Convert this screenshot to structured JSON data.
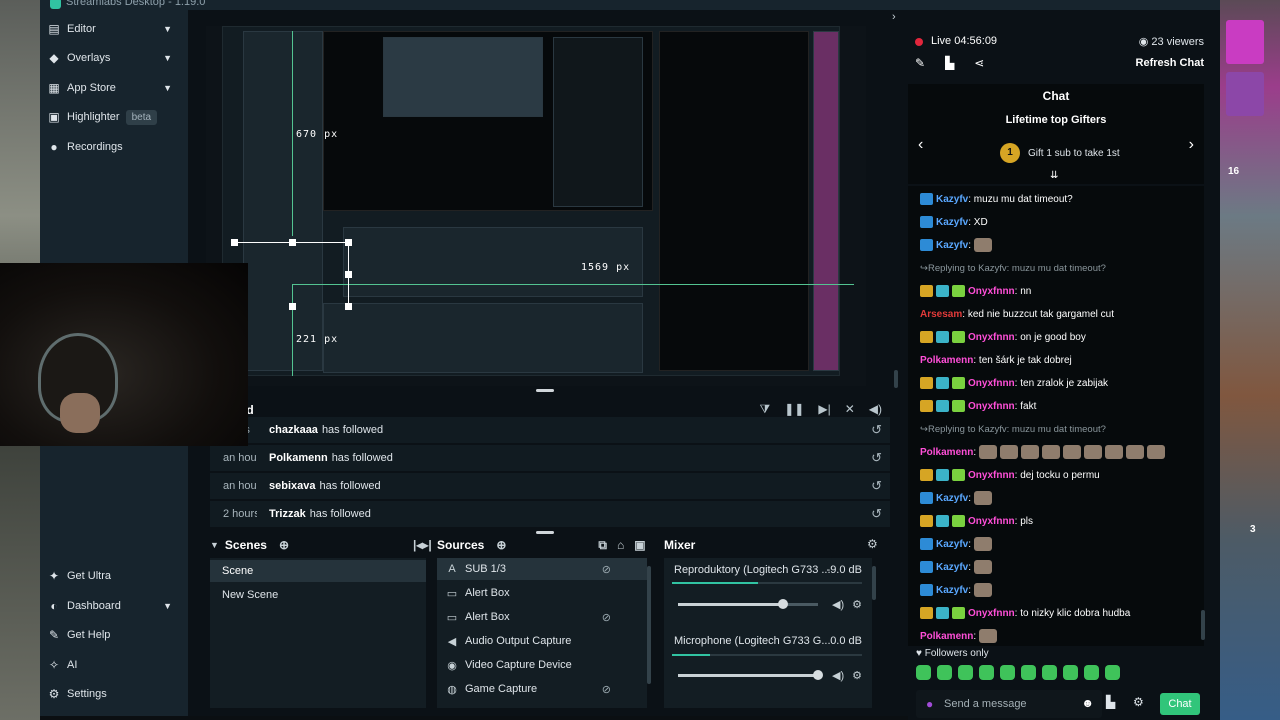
{
  "window": {
    "title": "Streamlabs Desktop - 1.19.0"
  },
  "sidebar": {
    "top_items": [
      {
        "label": "Editor",
        "icon": "editor-icon",
        "chevron": true
      },
      {
        "label": "Overlays",
        "icon": "overlays-icon",
        "chevron": true
      },
      {
        "label": "App Store",
        "icon": "app-store-icon",
        "chevron": true
      },
      {
        "label": "Highlighter",
        "icon": "highlighter-icon",
        "badge": "beta"
      },
      {
        "label": "Recordings",
        "icon": "recordings-icon"
      }
    ],
    "bottom_items": [
      {
        "label": "Get Ultra",
        "icon": "ultra-icon"
      },
      {
        "label": "Dashboard",
        "icon": "dashboard-icon",
        "chevron": true
      },
      {
        "label": "Get Help",
        "icon": "help-icon"
      },
      {
        "label": "AI",
        "icon": "ai-icon"
      },
      {
        "label": "Settings",
        "icon": "settings-icon"
      }
    ]
  },
  "preview": {
    "guides": {
      "top": "670 px",
      "right": "1569 px",
      "left": "221 px"
    }
  },
  "feed": {
    "title": "eed",
    "rows": [
      {
        "time": "nutes",
        "name": "chazkaaa",
        "action": "has followed"
      },
      {
        "time": "an hour",
        "name": "Polkamenn",
        "action": "has followed"
      },
      {
        "time": "an hour",
        "name": "sebixava",
        "action": "has followed"
      },
      {
        "time": "2 hours",
        "name": "Trizzak",
        "action": "has followed"
      }
    ]
  },
  "scenes": {
    "title": "Scenes",
    "items": [
      {
        "label": "Scene",
        "active": true
      },
      {
        "label": "New Scene",
        "active": false
      }
    ]
  },
  "sources": {
    "title": "Sources",
    "items": [
      {
        "label": "SUB 1/3",
        "icon": "text-icon",
        "hidden": true
      },
      {
        "label": "Alert Box",
        "icon": "alert-box-icon",
        "hidden": false
      },
      {
        "label": "Alert Box",
        "icon": "alert-box-icon",
        "hidden": true
      },
      {
        "label": "Audio Output Capture",
        "icon": "speaker-icon",
        "hidden": false
      },
      {
        "label": "Video Capture Device",
        "icon": "camera-icon",
        "hidden": false
      },
      {
        "label": "Game Capture",
        "icon": "gamepad-icon",
        "hidden": true
      }
    ]
  },
  "mixer": {
    "title": "Mixer",
    "channels": [
      {
        "name": "Reproduktory (Logitech G733 ...",
        "db": "-9.0 dB",
        "level": 0.45,
        "volume": 0.75
      },
      {
        "name": "Microphone (Logitech G733 G...",
        "db": "0.0 dB",
        "level": 0.2,
        "volume": 1.0
      }
    ]
  },
  "stream": {
    "live_label": "Live 04:56:09",
    "viewers": "23 viewers",
    "refresh_label": "Refresh Chat"
  },
  "chat": {
    "title": "Chat",
    "gifters_title": "Lifetime top Gifters",
    "gifters_text": "Gift 1 sub to take 1st",
    "gifters_rank": "1",
    "messages": [
      {
        "user": "Kazyfv",
        "color": "#5aa8ff",
        "text": ": muzu mu dat timeout?",
        "badges": [
          "prime"
        ]
      },
      {
        "user": "Kazyfv",
        "color": "#5aa8ff",
        "text": ": XD",
        "badges": [
          "prime"
        ]
      },
      {
        "user": "Kazyfv",
        "color": "#5aa8ff",
        "text": ":",
        "badges": [
          "prime"
        ],
        "emotes": 1
      },
      {
        "reply": "Replying to Kazyfv: muzu mu dat timeout?"
      },
      {
        "user": "Onyxfnnn",
        "color": "#ff4fd8",
        "text": ": nn",
        "badges": [
          "crown",
          "mod",
          "vip"
        ]
      },
      {
        "user": "Arsesam",
        "color": "#e23a3a",
        "text": ": ked nie buzzcut tak gargamel cut",
        "badges": []
      },
      {
        "user": "Onyxfnnn",
        "color": "#ff4fd8",
        "text": ": on je good boy",
        "badges": [
          "crown",
          "mod",
          "vip"
        ]
      },
      {
        "user": "Polkamenn",
        "color": "#ff4fd8",
        "text": ": ten šárk je tak dobrej",
        "badges": []
      },
      {
        "user": "Onyxfnnn",
        "color": "#ff4fd8",
        "text": ": ten zralok je zabijak",
        "badges": [
          "crown",
          "mod",
          "vip"
        ]
      },
      {
        "user": "Onyxfnnn",
        "color": "#ff4fd8",
        "text": ": fakt",
        "badges": [
          "crown",
          "mod",
          "vip"
        ]
      },
      {
        "reply": "Replying to Kazyfv: muzu mu dat timeout?"
      },
      {
        "user": "Polkamenn",
        "color": "#ff4fd8",
        "text": ":",
        "badges": [],
        "emotes": 9
      },
      {
        "user": "Onyxfnnn",
        "color": "#ff4fd8",
        "text": ": dej tocku o permu",
        "badges": [
          "crown",
          "mod",
          "vip"
        ]
      },
      {
        "user": "Kazyfv",
        "color": "#5aa8ff",
        "text": ":",
        "badges": [
          "prime"
        ],
        "emotes": 1
      },
      {
        "user": "Onyxfnnn",
        "color": "#ff4fd8",
        "text": ": pls",
        "badges": [
          "crown",
          "mod",
          "vip"
        ]
      },
      {
        "user": "Kazyfv",
        "color": "#5aa8ff",
        "text": ":",
        "badges": [
          "prime"
        ],
        "emotes": 1
      },
      {
        "user": "Kazyfv",
        "color": "#5aa8ff",
        "text": ":",
        "badges": [
          "prime"
        ],
        "emotes": 1
      },
      {
        "user": "Kazyfv",
        "color": "#5aa8ff",
        "text": ":",
        "badges": [
          "prime"
        ],
        "emotes": 1
      },
      {
        "user": "Onyxfnnn",
        "color": "#ff4fd8",
        "text": ": to nizky klic dobra hudba",
        "badges": [
          "crown",
          "mod",
          "vip"
        ]
      },
      {
        "user": "Polkamenn",
        "color": "#ff4fd8",
        "text": ":",
        "badges": [],
        "emotes": 1
      }
    ],
    "followers_only": "Followers only",
    "input_placeholder": "Send a message",
    "send_label": "Chat"
  },
  "colors": {
    "accent": "#31c3a2",
    "send_button": "#31c57a",
    "live": "#e2263c",
    "panel": "#17242d"
  },
  "background_game": {
    "labels": [
      "16",
      "3"
    ]
  }
}
